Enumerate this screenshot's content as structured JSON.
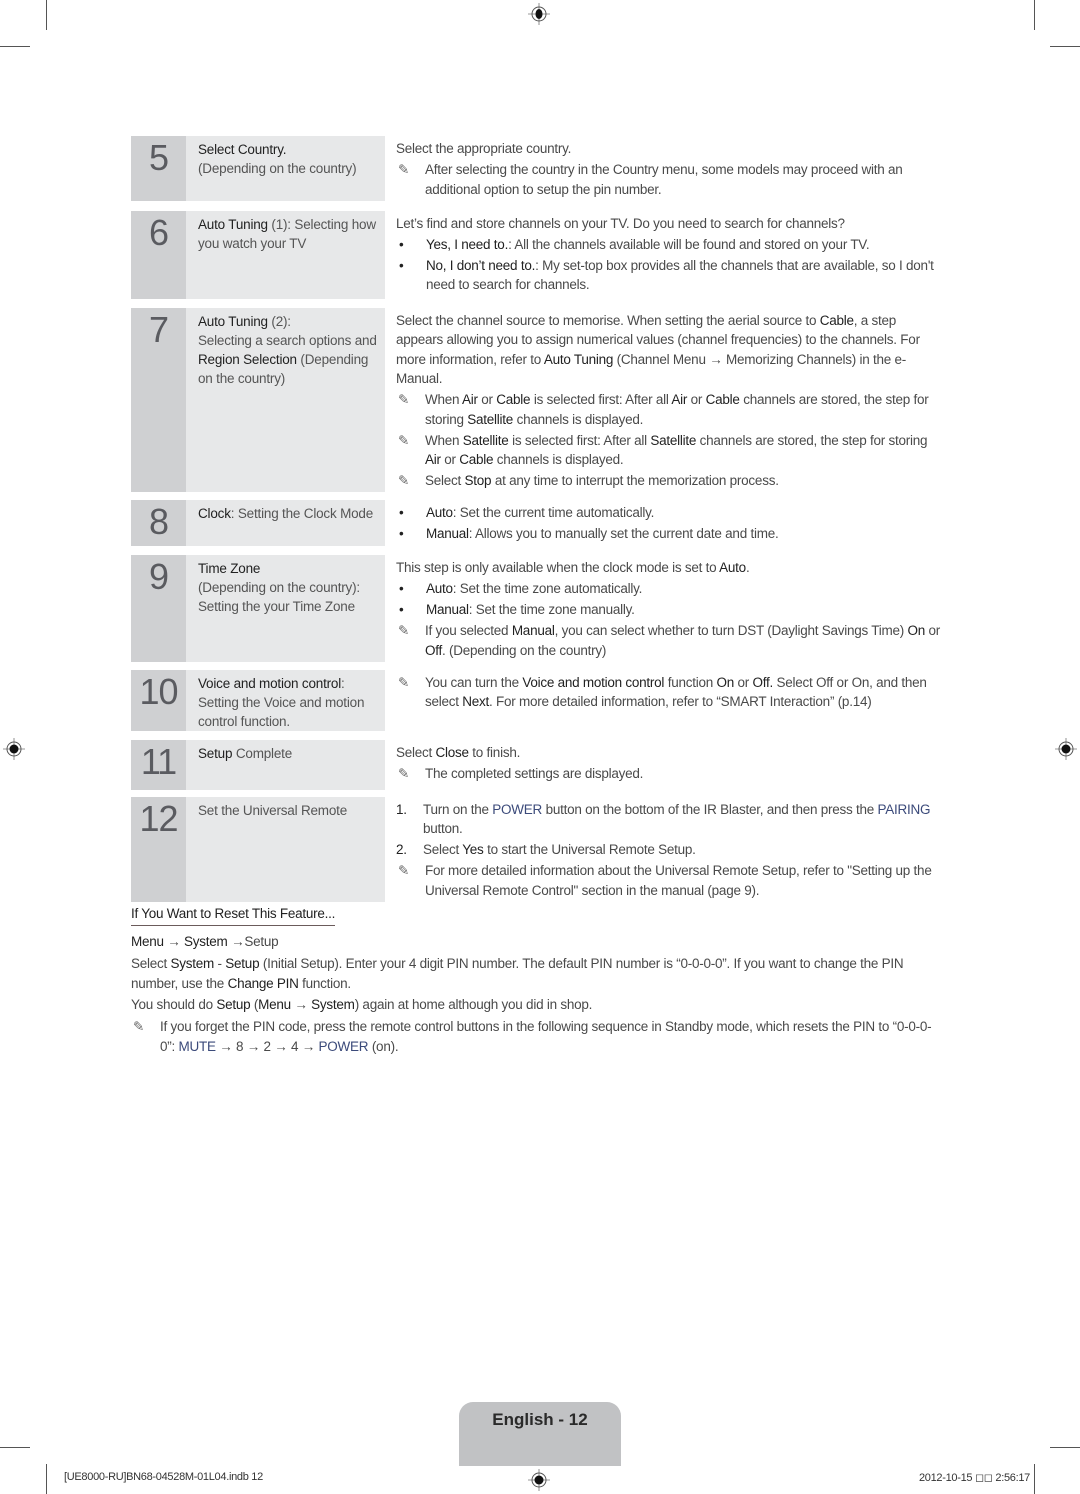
{
  "steps": [
    {
      "number": "5",
      "title": [
        {
          "t": "Select Country.",
          "b": true
        },
        {
          "br": true
        },
        {
          "t": "(Depending on the country)"
        }
      ],
      "content": [
        {
          "type": "text",
          "parts": [
            {
              "t": "Select the appropriate country."
            }
          ]
        },
        {
          "type": "note",
          "parts": [
            {
              "t": "After selecting the country in the Country menu, some models may proceed with an additional option to setup the pin number."
            }
          ]
        }
      ]
    },
    {
      "number": "6",
      "title": [
        {
          "t": "Auto Tuning",
          "b": true
        },
        {
          "t": " (1): Selecting how you watch your TV"
        }
      ],
      "content": [
        {
          "type": "text",
          "parts": [
            {
              "t": "Let’s find and store channels on your TV. Do you need to search for channels?"
            }
          ]
        },
        {
          "type": "bullet",
          "parts": [
            {
              "t": "Yes, I need to.",
              "b": true
            },
            {
              "t": ": All the channels available will be found and stored on your TV."
            }
          ]
        },
        {
          "type": "bullet",
          "parts": [
            {
              "t": "No, I don’t need to.",
              "b": true
            },
            {
              "t": ": My set-top box provides all the channels that are available, so I don't need to search for channels."
            }
          ]
        }
      ]
    },
    {
      "number": "7",
      "title": [
        {
          "t": "Auto Tuning",
          "b": true
        },
        {
          "t": " (2):"
        },
        {
          "br": true
        },
        {
          "t": "Selecting a search options and "
        },
        {
          "t": "Region Selection",
          "b": true
        },
        {
          "t": " (Depending on the country)"
        }
      ],
      "content": [
        {
          "type": "text",
          "parts": [
            {
              "t": "Select the channel source to memorise. When setting the aerial source to "
            },
            {
              "t": "Cable",
              "b": true
            },
            {
              "t": ", a step appears allowing you to assign numerical values (channel frequencies) to the channels. For more information, refer to "
            },
            {
              "t": "Auto Tuning",
              "b": true
            },
            {
              "t": " (Channel Menu → Memorizing Channels) in the e-Manual."
            }
          ]
        },
        {
          "type": "note",
          "parts": [
            {
              "t": "When "
            },
            {
              "t": "Air",
              "b": true
            },
            {
              "t": " or "
            },
            {
              "t": "Cable",
              "b": true
            },
            {
              "t": " is selected first: After all "
            },
            {
              "t": "Air",
              "b": true
            },
            {
              "t": " or "
            },
            {
              "t": "Cable",
              "b": true
            },
            {
              "t": " channels are stored, the step for storing "
            },
            {
              "t": "Satellite",
              "b": true
            },
            {
              "t": " channels is displayed."
            }
          ]
        },
        {
          "type": "note",
          "parts": [
            {
              "t": "When "
            },
            {
              "t": "Satellite",
              "b": true
            },
            {
              "t": " is selected first: After all "
            },
            {
              "t": "Satellite",
              "b": true
            },
            {
              "t": " channels are stored, the step for storing "
            },
            {
              "t": "Air",
              "b": true
            },
            {
              "t": " or "
            },
            {
              "t": "Cable",
              "b": true
            },
            {
              "t": " channels is displayed."
            }
          ]
        },
        {
          "type": "note",
          "parts": [
            {
              "t": "Select "
            },
            {
              "t": "Stop",
              "b": true
            },
            {
              "t": " at any time to interrupt the memorization process."
            }
          ]
        }
      ]
    },
    {
      "number": "8",
      "title": [
        {
          "t": "Clock",
          "b": true
        },
        {
          "t": ": Setting the Clock Mode"
        }
      ],
      "content": [
        {
          "type": "bullet",
          "parts": [
            {
              "t": "Auto",
              "b": true
            },
            {
              "t": ": Set the current time automatically."
            }
          ]
        },
        {
          "type": "bullet",
          "parts": [
            {
              "t": "Manual",
              "b": true
            },
            {
              "t": ": Allows you to manually set the current date and time."
            }
          ]
        }
      ]
    },
    {
      "number": "9",
      "title": [
        {
          "t": "Time Zone",
          "b": true
        },
        {
          "br": true
        },
        {
          "t": "(Depending on the country): Setting the your Time Zone"
        }
      ],
      "content": [
        {
          "type": "text",
          "parts": [
            {
              "t": "This step is only available when the clock mode is set to "
            },
            {
              "t": "Auto",
              "b": true
            },
            {
              "t": "."
            }
          ]
        },
        {
          "type": "bullet",
          "parts": [
            {
              "t": "Auto",
              "b": true
            },
            {
              "t": ": Set the time zone automatically."
            }
          ]
        },
        {
          "type": "bullet",
          "parts": [
            {
              "t": "Manual",
              "b": true
            },
            {
              "t": ": Set the time zone manually."
            }
          ]
        },
        {
          "type": "note",
          "parts": [
            {
              "t": "If you selected "
            },
            {
              "t": "Manual",
              "b": true
            },
            {
              "t": ", you can select whether to turn DST (Daylight Savings Time) "
            },
            {
              "t": "On",
              "b": true
            },
            {
              "t": " or "
            },
            {
              "t": "Off",
              "b": true
            },
            {
              "t": ". (Depending on the country)"
            }
          ]
        }
      ]
    },
    {
      "number": "10",
      "title": [
        {
          "t": "Voice and motion control",
          "b": true
        },
        {
          "t": ": Setting the Voice and motion control function."
        }
      ],
      "content": [
        {
          "type": "note",
          "parts": [
            {
              "t": "You can turn the "
            },
            {
              "t": "Voice and motion control",
              "b": true
            },
            {
              "t": " function "
            },
            {
              "t": "On",
              "b": true
            },
            {
              "t": " or "
            },
            {
              "t": "Off.",
              "b": true
            },
            {
              "t": " Select Off or On, and then select "
            },
            {
              "t": "Next",
              "b": true
            },
            {
              "t": ". For more detailed information, refer to “SMART Interaction” (p.14)"
            }
          ]
        }
      ]
    },
    {
      "number": "11",
      "title": [
        {
          "t": "Setup",
          "b": true
        },
        {
          "t": " Complete"
        }
      ],
      "content": [
        {
          "type": "text",
          "parts": [
            {
              "t": "Select "
            },
            {
              "t": "Close",
              "b": true
            },
            {
              "t": " to finish."
            }
          ]
        },
        {
          "type": "note",
          "parts": [
            {
              "t": "The completed settings are displayed."
            }
          ]
        }
      ]
    },
    {
      "number": "12",
      "title": [
        {
          "t": "Set the Universal Remote"
        }
      ],
      "content": [
        {
          "type": "ol",
          "n": "1.",
          "parts": [
            {
              "t": "Turn on the "
            },
            {
              "t": "POWER",
              "blue": true
            },
            {
              "t": " button on the bottom of the IR Blaster, and then press the "
            },
            {
              "t": "PAIRING",
              "blue": true
            },
            {
              "t": " button."
            }
          ]
        },
        {
          "type": "ol",
          "n": "2.",
          "parts": [
            {
              "t": "Select "
            },
            {
              "t": "Yes",
              "b": true
            },
            {
              "t": " to start the Universal Remote Setup."
            }
          ]
        },
        {
          "type": "note",
          "parts": [
            {
              "t": "For more detailed information about the Universal Remote Setup, refer to \"Setting up the Universal Remote Control\" section in the manual (page 9)."
            }
          ]
        }
      ]
    }
  ],
  "reset": {
    "heading": "If You Want to Reset This Feature...",
    "paragraphs": [
      {
        "type": "text",
        "parts": [
          {
            "t": "Menu",
            "b": true
          },
          {
            "t": " → "
          },
          {
            "t": "System",
            "b": true
          },
          {
            "t": " →Setup"
          }
        ]
      },
      {
        "type": "text",
        "parts": [
          {
            "t": "Select "
          },
          {
            "t": "System",
            "b": true
          },
          {
            "t": " - "
          },
          {
            "t": "Setup",
            "b": true
          },
          {
            "t": " (Initial Setup). Enter your 4 digit PIN number. The default PIN number is “0-0-0-0”. If you want to change the PIN number, use the "
          },
          {
            "t": "Change PIN",
            "b": true
          },
          {
            "t": " function."
          }
        ]
      },
      {
        "type": "text",
        "parts": [
          {
            "t": "You should do "
          },
          {
            "t": "Setup",
            "b": true
          },
          {
            "t": " ("
          },
          {
            "t": "Menu",
            "b": true
          },
          {
            "t": " → "
          },
          {
            "t": "System",
            "b": true
          },
          {
            "t": ") again at home although you did in shop."
          }
        ]
      },
      {
        "type": "note",
        "parts": [
          {
            "t": "If you forget the PIN code, press the remote control buttons in the following sequence in Standby mode, which resets the PIN to “0-0-0-0”: "
          },
          {
            "t": "MUTE",
            "blue": true
          },
          {
            "t": " → 8 → 2 → 4 → "
          },
          {
            "t": "POWER",
            "blue": true
          },
          {
            "t": " (on)."
          }
        ]
      }
    ]
  },
  "footer": {
    "page_label": "English - 12",
    "file_slug": "[UE8000-RU]BN68-04528M-01L04.indb   12",
    "timestamp": "2012-10-15   ◻◻ 2:56:17"
  },
  "icons": {
    "note": "✎",
    "bullet": "•"
  }
}
